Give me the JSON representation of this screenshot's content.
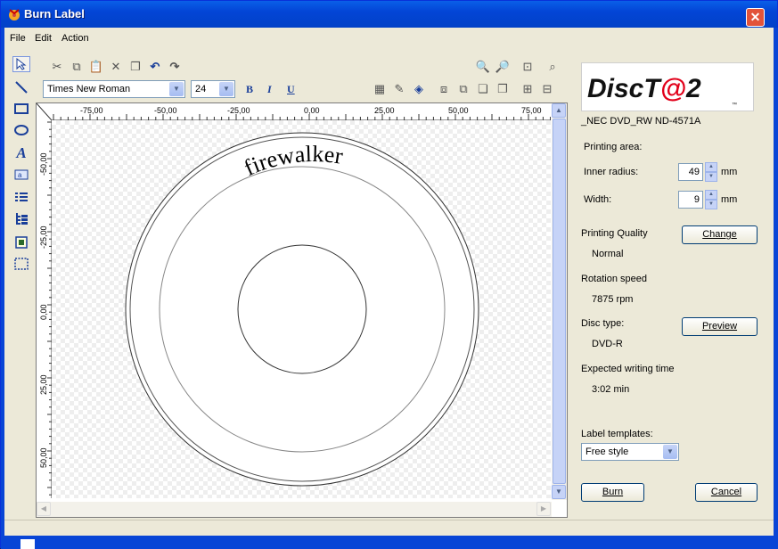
{
  "window": {
    "title": "Burn Label",
    "close_glyph": "✕"
  },
  "menu": {
    "items": [
      "File",
      "Edit",
      "Action"
    ]
  },
  "tools": {
    "left": [
      "select-arrow-icon",
      "line-icon",
      "rectangle-icon",
      "ellipse-icon",
      "text-icon",
      "text-box-icon",
      "list-icon",
      "tree-list-icon",
      "image-icon",
      "frame-select-icon"
    ]
  },
  "toolbar": {
    "font": "Times New Roman",
    "size": "24",
    "bold": "B",
    "italic": "I",
    "underline": "U"
  },
  "ruler": {
    "h_labels": [
      "-75,00",
      "-50,00",
      "-25,00",
      "0,00",
      "25,00",
      "50,00",
      "75,00"
    ],
    "v_labels": [
      "-50,00",
      "-25,00",
      "0,00",
      "25,00",
      "50,00"
    ]
  },
  "canvas": {
    "label_text": "firewalker"
  },
  "panel": {
    "logo_text": "DiscT@2",
    "logo_tm": "™",
    "drive": "_NEC DVD_RW ND-4571A",
    "printing_area": "Printing area:",
    "inner_radius_label": "Inner radius:",
    "inner_radius_value": "49",
    "width_label": "Width:",
    "width_value": "9",
    "unit": "mm",
    "quality_label": "Printing Quality",
    "quality_value": "Normal",
    "change_button": "Change",
    "rotation_label": "Rotation speed",
    "rotation_value": "7875 rpm",
    "disc_type_label": "Disc type:",
    "disc_type_value": "DVD-R",
    "preview_button": "Preview",
    "writing_time_label": "Expected writing time",
    "writing_time_value": "3:02 min",
    "templates_label": "Label templates:",
    "templates_value": "Free style",
    "burn_button": "Burn",
    "cancel_button": "Cancel"
  },
  "colors": {
    "titlebar": "#0345d6",
    "accent_red": "#e2001a",
    "window_bg": "#ece9d8"
  }
}
